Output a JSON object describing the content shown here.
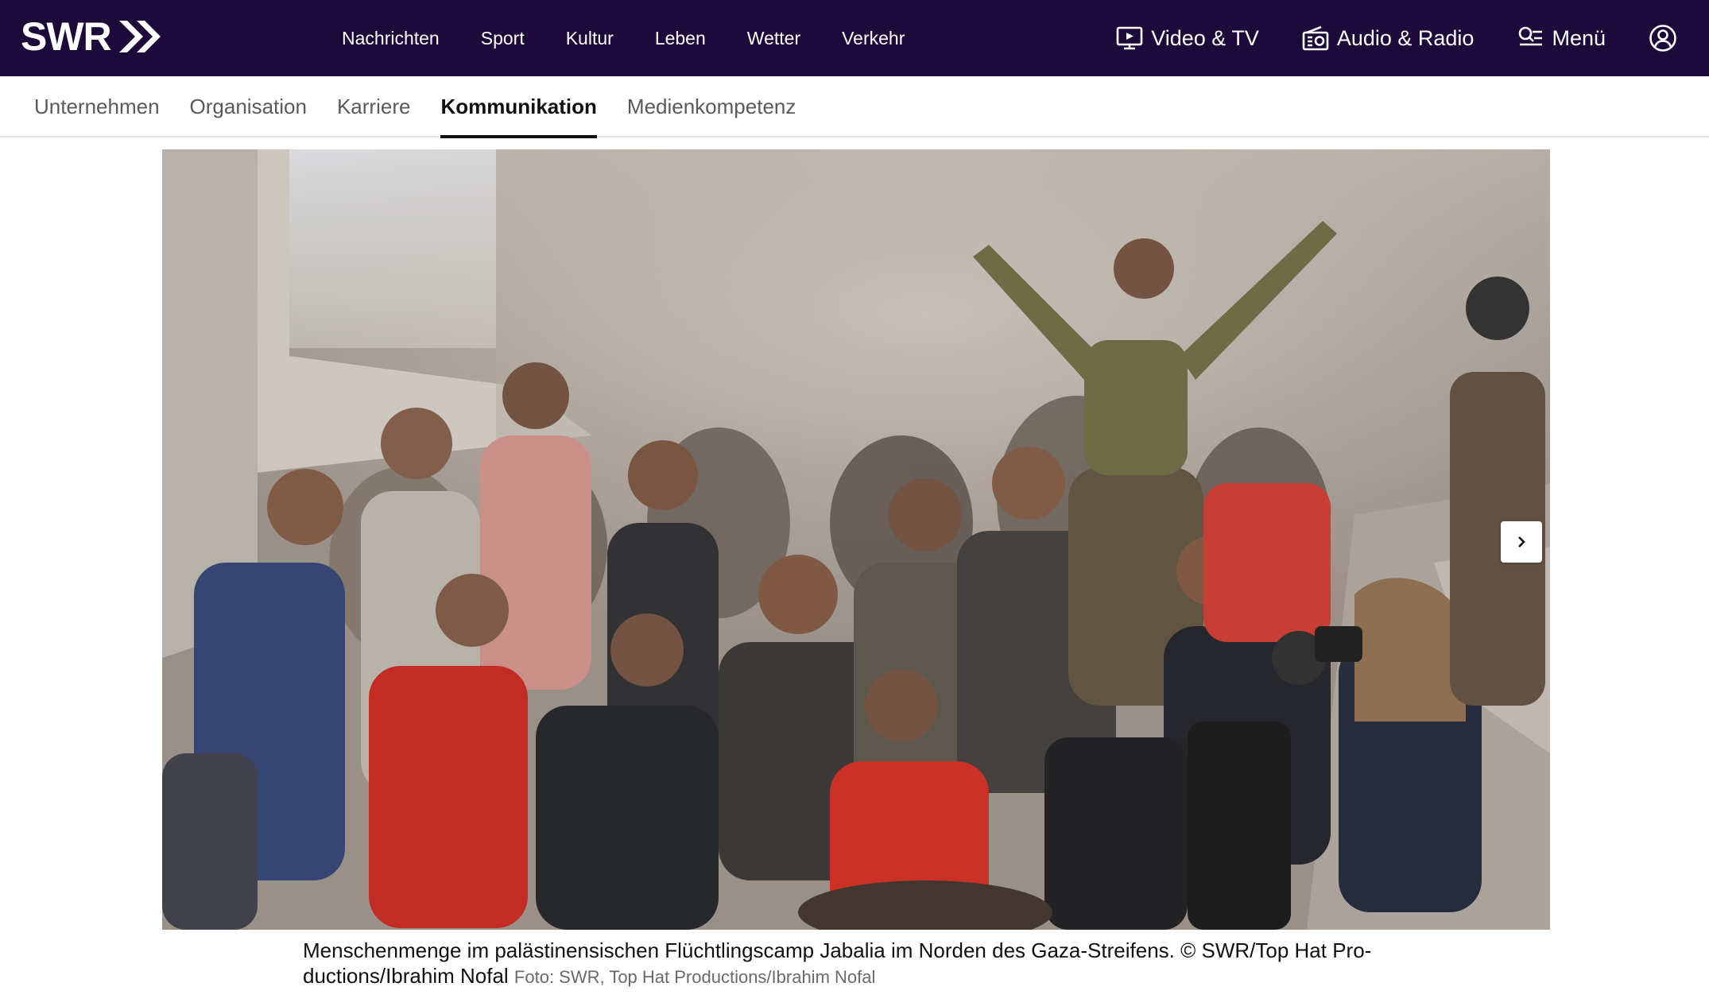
{
  "header": {
    "logo_text": "SWR",
    "nav": [
      "Nachrichten",
      "Sport",
      "Kultur",
      "Leben",
      "Wetter",
      "Verkehr"
    ],
    "video_tv_label": "Video & TV",
    "audio_radio_label": "Audio & Radio",
    "menu_label": "Menü",
    "bg_color": "#1c0a3a"
  },
  "subnav": {
    "items": [
      "Unternehmen",
      "Organisation",
      "Karriere",
      "Kommunikation",
      "Medienkompetenz"
    ],
    "active": "Kommunikation"
  },
  "hero": {
    "image_alt": "Menschenmenge im palästinensischen Flüchtlingscamp Jabalia im Norden des Gaza-Streifens.",
    "next_icon": "chevron-right-icon"
  },
  "caption": {
    "text": "Menschenmenge im palästinensischen Flüchtlingscamp Jabalia im Norden des Gaza-Streifens. © SWR/Top Hat Pro-ductions/Ibrahim Nofal",
    "credit": "Foto: SWR, Top Hat Productions/Ibrahim Nofal"
  }
}
